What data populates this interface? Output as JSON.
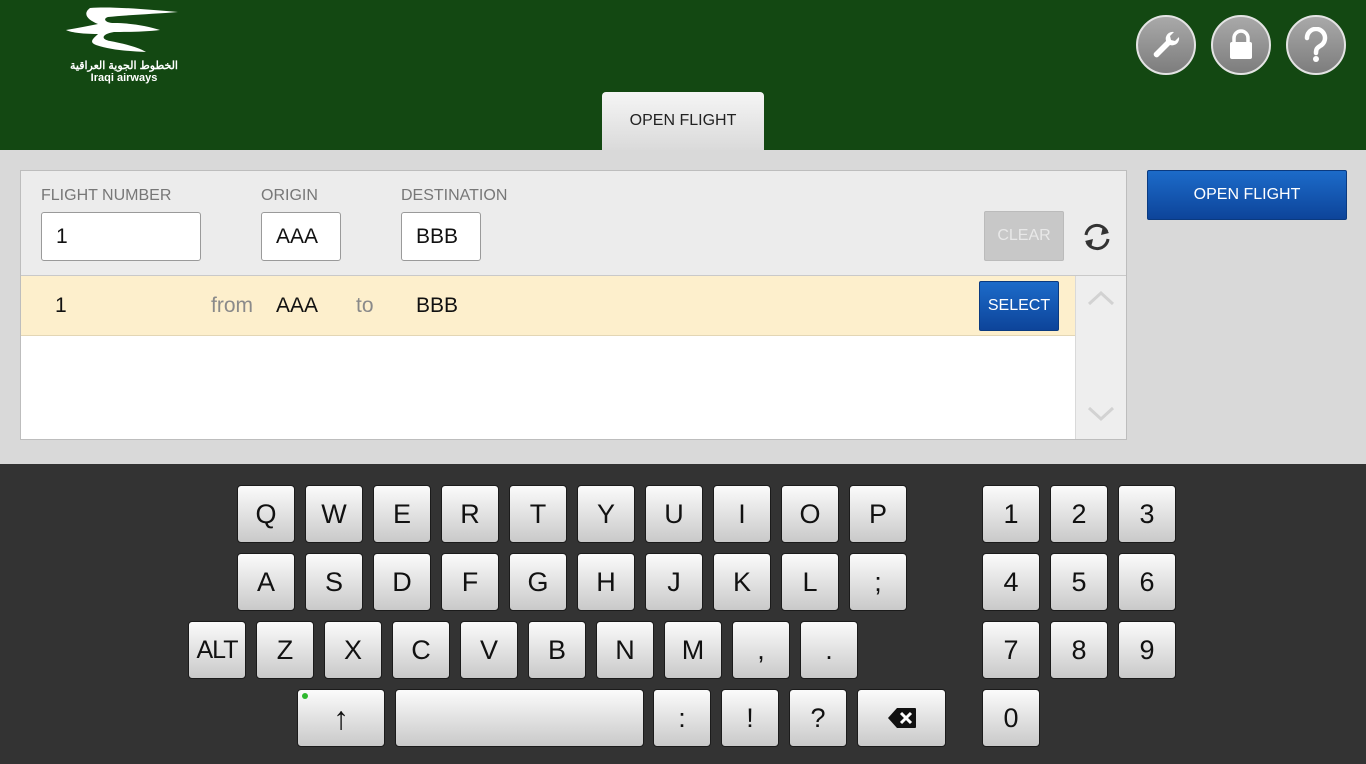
{
  "header": {
    "logo_arabic": "الخطوط الجوية العراقية",
    "logo_english": "Iraqi airways",
    "tab_label": "OPEN FLIGHT",
    "icons": [
      "wrench-icon",
      "lock-icon",
      "help-icon"
    ]
  },
  "filters": {
    "flight_number_label": "FLIGHT NUMBER",
    "flight_number_value": "1",
    "origin_label": "ORIGIN",
    "origin_value": "AAA",
    "destination_label": "DESTINATION",
    "destination_value": "BBB",
    "clear_label": "CLEAR"
  },
  "results": [
    {
      "flight": "1",
      "from_label": "from",
      "origin": "AAA",
      "to_label": "to",
      "destination": "BBB",
      "select_label": "SELECT"
    }
  ],
  "open_flight_label": "OPEN FLIGHT",
  "keyboard": {
    "row1": [
      "Q",
      "W",
      "E",
      "R",
      "T",
      "Y",
      "U",
      "I",
      "O",
      "P"
    ],
    "row2": [
      "A",
      "S",
      "D",
      "F",
      "G",
      "H",
      "J",
      "K",
      "L",
      ";"
    ],
    "row3": [
      "ALT",
      "Z",
      "X",
      "C",
      "V",
      "B",
      "N",
      "M",
      ",",
      "."
    ],
    "row4": [
      "↑",
      "",
      ":",
      "!",
      "?",
      "⌫"
    ],
    "numpad": [
      "1",
      "2",
      "3",
      "4",
      "5",
      "6",
      "7",
      "8",
      "9",
      "0"
    ]
  },
  "colors": {
    "header": "#134812",
    "accent_blue": "#0d449a",
    "selected_row": "#fdefcc",
    "keyboard_bg": "#333333",
    "shift_indicator": "#2eb82e"
  }
}
